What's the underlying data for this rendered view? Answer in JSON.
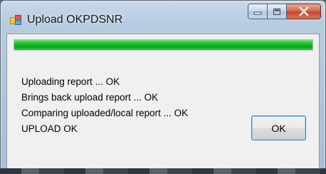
{
  "window": {
    "title": "Upload OKPDSNR",
    "progress_fraction": 1.0
  },
  "caption_buttons": {
    "minimize_icon": "minimize-icon",
    "maximize_icon": "maximize-icon",
    "close_icon": "close-icon"
  },
  "log_lines": [
    "Uploading report ... OK",
    "Brings back upload report ... OK",
    "Comparing uploaded/local report ... OK",
    "UPLOAD OK"
  ],
  "ok_button_label": "OK",
  "colors": {
    "progress": "#07a815",
    "button_border": "#3c7fb1"
  }
}
